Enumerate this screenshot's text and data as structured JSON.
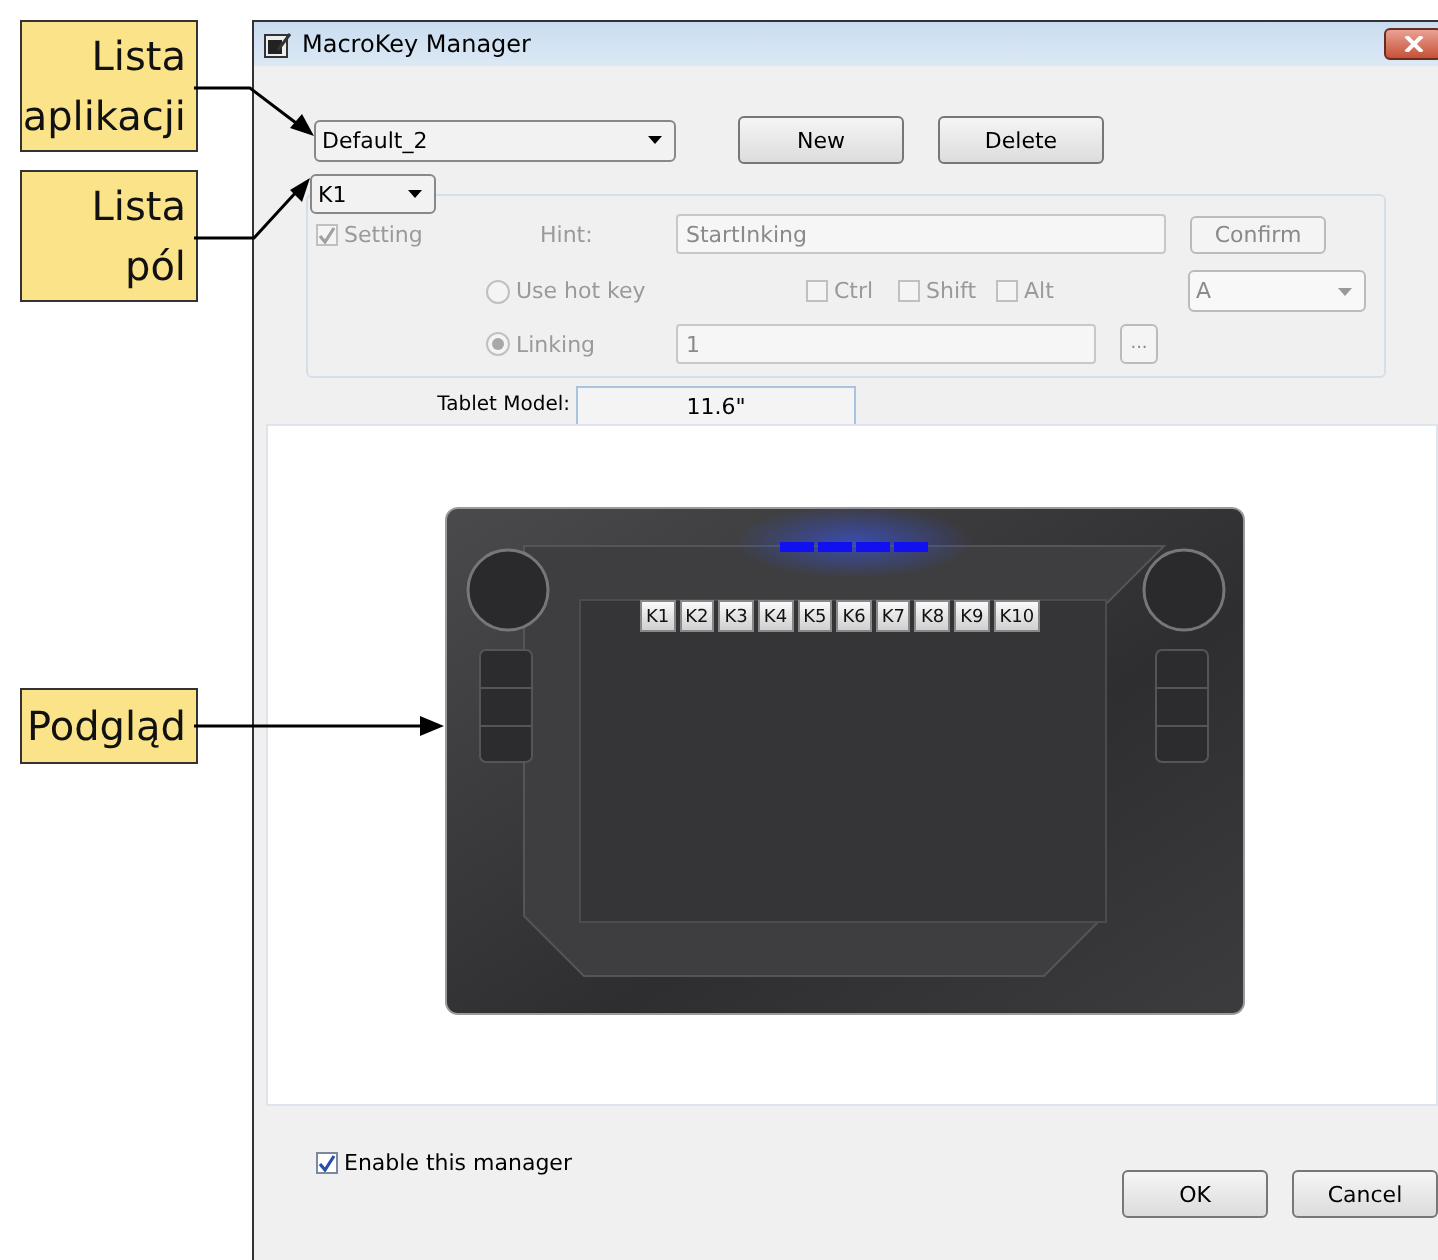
{
  "callouts": [
    {
      "text": "Lista aplikacji"
    },
    {
      "text": "Lista pól"
    },
    {
      "text": "Podgląd"
    }
  ],
  "window": {
    "title": "MacroKey Manager"
  },
  "application_list": {
    "value": "Default_2"
  },
  "top_buttons": [
    "New",
    "Delete"
  ],
  "field_list": {
    "value": "K1"
  },
  "key_settings": {
    "disabled": true,
    "setting": {
      "label": "Setting",
      "checked": true
    },
    "hint": {
      "label": "Hint:",
      "value": "StartInking"
    },
    "confirm_button": "Confirm",
    "modes": [
      {
        "kind": "hotkey",
        "label": "Use hot key",
        "selected": false
      },
      {
        "kind": "linking",
        "label": "Linking",
        "selected": true
      }
    ],
    "modifiers": [
      {
        "label": "Ctrl",
        "checked": false
      },
      {
        "label": "Shift",
        "checked": false
      },
      {
        "label": "Alt",
        "checked": false
      }
    ],
    "hot_key": {
      "value": "A"
    },
    "linking": {
      "value": "1",
      "browse_button": "..."
    }
  },
  "tablet_model": {
    "label": "Tablet Model:",
    "value": "11.6\""
  },
  "preview_keys": [
    "K1",
    "K2",
    "K3",
    "K4",
    "K5",
    "K6",
    "K7",
    "K8",
    "K9",
    "K10"
  ],
  "enable_manager": {
    "label": "Enable this manager",
    "checked": true
  },
  "bottom_buttons": [
    "OK",
    "Cancel"
  ]
}
